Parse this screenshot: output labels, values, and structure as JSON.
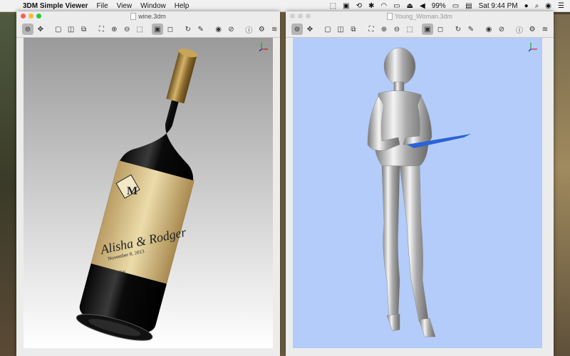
{
  "menubar": {
    "apple": "",
    "app_name": "3DM Simple Viewer",
    "menus": [
      "File",
      "View",
      "Window",
      "Help"
    ],
    "battery": "99%",
    "clock": "Sat 9:44 PM"
  },
  "windows": [
    {
      "title": "wine.3dm",
      "label": {
        "monogram": "M",
        "names": "Alisha & Rodger",
        "date": "November 8, 2013",
        "thanks": "Thank You"
      }
    },
    {
      "title": "Young_Woman.3dm"
    }
  ],
  "toolbar_icons": [
    "rotate-icon",
    "pan-icon",
    "box-front-icon",
    "box-side-icon",
    "box-persp-icon",
    "zoom-extents-icon",
    "zoom-in-icon",
    "zoom-out-icon",
    "zoom-window-icon",
    "shaded-icon",
    "wireframe-icon",
    "orbit-icon",
    "measure-icon",
    "show-icon",
    "hide-icon",
    "info-icon",
    "settings-icon",
    "layers-icon"
  ],
  "colors": {
    "close": "#fc5f57",
    "minimize": "#fdbb2e",
    "zoom": "#2ac940",
    "viewport_blue": "#b3ccf9"
  }
}
